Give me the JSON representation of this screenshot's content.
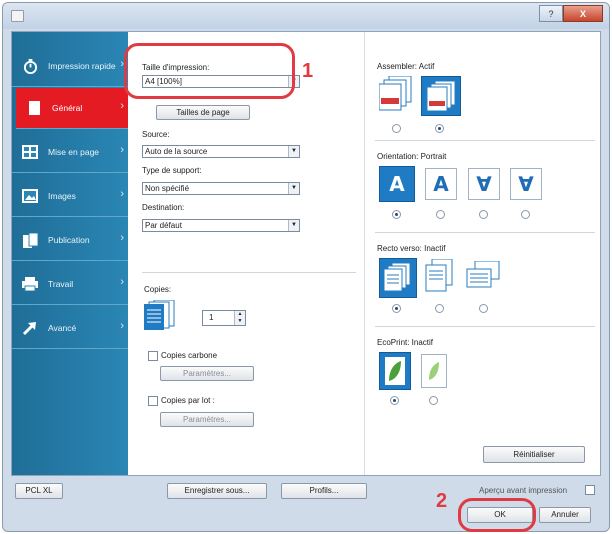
{
  "window": {
    "controls": {
      "help": "?",
      "close": "X"
    }
  },
  "sidebar": {
    "items": [
      {
        "label": "Impression rapide",
        "icon": "stopwatch-icon"
      },
      {
        "label": "Général",
        "icon": "document-icon"
      },
      {
        "label": "Mise en page",
        "icon": "layout-icon"
      },
      {
        "label": "Images",
        "icon": "image-icon"
      },
      {
        "label": "Publication",
        "icon": "booklet-icon"
      },
      {
        "label": "Travail",
        "icon": "printer-icon"
      },
      {
        "label": "Avancé",
        "icon": "arrow-icon"
      }
    ],
    "active_index": 1
  },
  "general": {
    "page_size_label": "Taille d'impression:",
    "page_size_value": "A4 [100%]",
    "page_sizes_button": "Tailles de page",
    "source_label": "Source:",
    "source_value": "Auto de la source",
    "media_label": "Type de support:",
    "media_value": "Non spécifié",
    "destination_label": "Destination:",
    "destination_value": "Par défaut",
    "copies_label": "Copies:",
    "copies_value": "1",
    "carbon_copies_label": "Copies carbone",
    "carbon_settings_button": "Paramètres...",
    "copies_per_set_label": "Copies par lot :",
    "set_settings_button": "Paramètres..."
  },
  "right": {
    "collate_label": "Assembler: Actif",
    "orientation_label": "Orientation: Portrait",
    "orientation_glyphs": [
      "A",
      "A",
      "∀",
      "∀"
    ],
    "duplex_label": "Recto verso: Inactif",
    "ecoprint_label": "EcoPrint: Inactif",
    "reset_button": "Réinitialiser"
  },
  "footer": {
    "pdl_button": "PCL XL",
    "save_as_button": "Enregistrer sous...",
    "profiles_button": "Profils...",
    "preview_label": "Aperçu avant impression",
    "ok_button": "OK",
    "cancel_button": "Annuler"
  },
  "callouts": {
    "one": "1",
    "two": "2"
  },
  "colors": {
    "accent_red": "#e23a42",
    "sidebar_blue": "#2a86b4",
    "active_nav": "#e41b23"
  }
}
